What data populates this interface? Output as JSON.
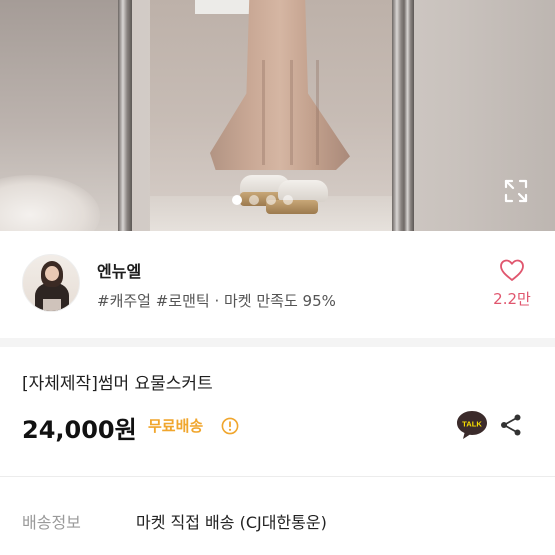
{
  "gallery": {
    "image_alt": "product photo",
    "slide_count": 4,
    "active_slide": 1
  },
  "seller": {
    "name": "엔뉴엘",
    "tags": "#캐주얼 #로맨틱 · 마켓 만족도 95%",
    "like_count": "2.2만"
  },
  "product": {
    "title": "[자체제작]썸머 요물스커트",
    "price": "24,000원",
    "shipping_badge": "무료배송"
  },
  "shipping": {
    "label": "배송정보",
    "value": "마켓 직접 배송 (CJ대한통운)"
  },
  "colors": {
    "like": "#e0566e",
    "free_shipping": "#f0a62d",
    "talk_badge": "#3b2b2b"
  },
  "icons": {
    "expand": "expand-icon",
    "heart": "heart-icon",
    "info": "info-icon",
    "talk": "kakao-talk-icon",
    "share": "share-icon"
  }
}
